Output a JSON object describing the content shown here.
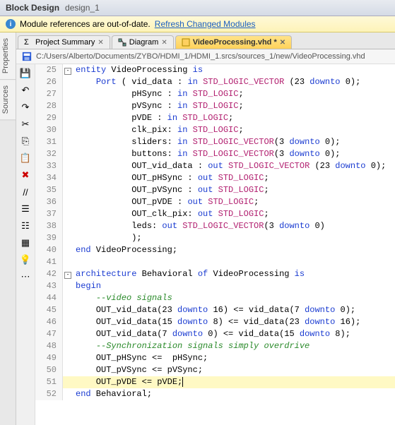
{
  "titlebar": {
    "title": "Block Design",
    "subtitle": "design_1"
  },
  "warning": {
    "text": "Module references are out-of-date.",
    "link": "Refresh Changed Modules"
  },
  "side_panels": [
    {
      "name": "properties",
      "label": "Properties"
    },
    {
      "name": "sources",
      "label": "Sources"
    }
  ],
  "tabs": [
    {
      "name": "project-summary",
      "label": "Project Summary",
      "active": false,
      "icon": "sigma"
    },
    {
      "name": "diagram",
      "label": "Diagram",
      "active": false,
      "icon": "diagram"
    },
    {
      "name": "videoprocessing",
      "label": "VideoProcessing.vhd *",
      "active": true,
      "icon": "vhd"
    }
  ],
  "path": "C:/Users/Alberto/Documents/ZYBO/HDMI_1/HDMI_1.srcs/sources_1/new/VideoProcessing.vhd",
  "toolbar_v": [
    {
      "name": "save-icon",
      "glyph": "💾"
    },
    {
      "name": "undo-icon",
      "glyph": "↶"
    },
    {
      "name": "redo-icon",
      "glyph": "↷"
    },
    {
      "name": "cut-icon",
      "glyph": "✂"
    },
    {
      "name": "copy-icon",
      "glyph": "⎘"
    },
    {
      "name": "paste-icon",
      "glyph": "📋"
    },
    {
      "name": "delete-icon",
      "glyph": "✖",
      "color": "#c00"
    },
    {
      "name": "toggle-comment-icon",
      "glyph": "//"
    },
    {
      "name": "indent-icon",
      "glyph": "☰"
    },
    {
      "name": "outdent-icon",
      "glyph": "☷"
    },
    {
      "name": "syntax-icon",
      "glyph": "▦"
    },
    {
      "name": "hint-icon",
      "glyph": "💡"
    },
    {
      "name": "more-icon",
      "glyph": "⋯"
    }
  ],
  "first_line_no": 25,
  "highlight_line": 51,
  "code": [
    {
      "fold": "-",
      "tokens": [
        [
          "kw",
          "entity"
        ],
        [
          "",
          " VideoProcessing "
        ],
        [
          "kw",
          "is"
        ]
      ]
    },
    {
      "tokens": [
        [
          "",
          "    "
        ],
        [
          "kw",
          "Port"
        ],
        [
          "",
          " ( vid_data : "
        ],
        [
          "kw",
          "in"
        ],
        [
          "",
          " "
        ],
        [
          "ty",
          "STD_LOGIC_VECTOR"
        ],
        [
          "",
          " (23 "
        ],
        [
          "kw",
          "downto"
        ],
        [
          "",
          " 0);"
        ]
      ]
    },
    {
      "tokens": [
        [
          "",
          "           pHSync : "
        ],
        [
          "kw",
          "in"
        ],
        [
          "",
          " "
        ],
        [
          "ty",
          "STD_LOGIC"
        ],
        [
          "",
          ";"
        ]
      ]
    },
    {
      "tokens": [
        [
          "",
          "           pVSync : "
        ],
        [
          "kw",
          "in"
        ],
        [
          "",
          " "
        ],
        [
          "ty",
          "STD_LOGIC"
        ],
        [
          "",
          ";"
        ]
      ]
    },
    {
      "tokens": [
        [
          "",
          "           pVDE : "
        ],
        [
          "kw",
          "in"
        ],
        [
          "",
          " "
        ],
        [
          "ty",
          "STD_LOGIC"
        ],
        [
          "",
          ";"
        ]
      ]
    },
    {
      "tokens": [
        [
          "",
          "           clk_pix: "
        ],
        [
          "kw",
          "in"
        ],
        [
          "",
          " "
        ],
        [
          "ty",
          "STD_LOGIC"
        ],
        [
          "",
          ";"
        ]
      ]
    },
    {
      "tokens": [
        [
          "",
          "           sliders: "
        ],
        [
          "kw",
          "in"
        ],
        [
          "",
          " "
        ],
        [
          "ty",
          "STD_LOGIC_VECTOR"
        ],
        [
          "",
          "(3 "
        ],
        [
          "kw",
          "downto"
        ],
        [
          "",
          " 0);"
        ]
      ]
    },
    {
      "tokens": [
        [
          "",
          "           buttons: "
        ],
        [
          "kw",
          "in"
        ],
        [
          "",
          " "
        ],
        [
          "ty",
          "STD_LOGIC_VECTOR"
        ],
        [
          "",
          "(3 "
        ],
        [
          "kw",
          "downto"
        ],
        [
          "",
          " 0);"
        ]
      ]
    },
    {
      "tokens": [
        [
          "",
          "           OUT_vid_data : "
        ],
        [
          "kw",
          "out"
        ],
        [
          "",
          " "
        ],
        [
          "ty",
          "STD_LOGIC_VECTOR"
        ],
        [
          "",
          " (23 "
        ],
        [
          "kw",
          "downto"
        ],
        [
          "",
          " 0);"
        ]
      ]
    },
    {
      "tokens": [
        [
          "",
          "           OUT_pHSync : "
        ],
        [
          "kw",
          "out"
        ],
        [
          "",
          " "
        ],
        [
          "ty",
          "STD_LOGIC"
        ],
        [
          "",
          ";"
        ]
      ]
    },
    {
      "tokens": [
        [
          "",
          "           OUT_pVSync : "
        ],
        [
          "kw",
          "out"
        ],
        [
          "",
          " "
        ],
        [
          "ty",
          "STD_LOGIC"
        ],
        [
          "",
          ";"
        ]
      ]
    },
    {
      "tokens": [
        [
          "",
          "           OUT_pVDE : "
        ],
        [
          "kw",
          "out"
        ],
        [
          "",
          " "
        ],
        [
          "ty",
          "STD_LOGIC"
        ],
        [
          "",
          ";"
        ]
      ]
    },
    {
      "tokens": [
        [
          "",
          "           OUT_clk_pix: "
        ],
        [
          "kw",
          "out"
        ],
        [
          "",
          " "
        ],
        [
          "ty",
          "STD_LOGIC"
        ],
        [
          "",
          ";"
        ]
      ]
    },
    {
      "tokens": [
        [
          "",
          "           leds: "
        ],
        [
          "kw",
          "out"
        ],
        [
          "",
          " "
        ],
        [
          "ty",
          "STD_LOGIC_VECTOR"
        ],
        [
          "",
          "(3 "
        ],
        [
          "kw",
          "downto"
        ],
        [
          "",
          " 0)"
        ]
      ]
    },
    {
      "tokens": [
        [
          "",
          "           );"
        ]
      ]
    },
    {
      "tokens": [
        [
          "kw",
          "end"
        ],
        [
          "",
          " VideoProcessing;"
        ]
      ]
    },
    {
      "tokens": [
        [
          "",
          ""
        ]
      ]
    },
    {
      "fold": "-",
      "tokens": [
        [
          "kw",
          "architecture"
        ],
        [
          "",
          " Behavioral "
        ],
        [
          "kw",
          "of"
        ],
        [
          "",
          " VideoProcessing "
        ],
        [
          "kw",
          "is"
        ]
      ]
    },
    {
      "tokens": [
        [
          "kw",
          "begin"
        ]
      ]
    },
    {
      "tokens": [
        [
          "",
          "    "
        ],
        [
          "cm",
          "--video signals"
        ]
      ]
    },
    {
      "tokens": [
        [
          "",
          "    OUT_vid_data(23 "
        ],
        [
          "kw",
          "downto"
        ],
        [
          "",
          " 16) <= vid_data(7 "
        ],
        [
          "kw",
          "downto"
        ],
        [
          "",
          " 0);"
        ]
      ]
    },
    {
      "tokens": [
        [
          "",
          "    OUT_vid_data(15 "
        ],
        [
          "kw",
          "downto"
        ],
        [
          "",
          " 8) <= vid_data(23 "
        ],
        [
          "kw",
          "downto"
        ],
        [
          "",
          " 16);"
        ]
      ]
    },
    {
      "tokens": [
        [
          "",
          "    OUT_vid_data(7 "
        ],
        [
          "kw",
          "downto"
        ],
        [
          "",
          " 0) <= vid_data(15 "
        ],
        [
          "kw",
          "downto"
        ],
        [
          "",
          " 8);"
        ]
      ]
    },
    {
      "tokens": [
        [
          "",
          "    "
        ],
        [
          "cm",
          "--Synchronization signals simply overdrive"
        ]
      ]
    },
    {
      "tokens": [
        [
          "",
          "    OUT_pHSync <=  pHSync;"
        ]
      ]
    },
    {
      "tokens": [
        [
          "",
          "    OUT_pVSync <= pVSync;"
        ]
      ]
    },
    {
      "tokens": [
        [
          "",
          "    OUT_pVDE <= pVDE;"
        ]
      ],
      "caret": true
    },
    {
      "fold": "",
      "tokens": [
        [
          "kw",
          "end"
        ],
        [
          "",
          " Behavioral;"
        ]
      ]
    }
  ]
}
